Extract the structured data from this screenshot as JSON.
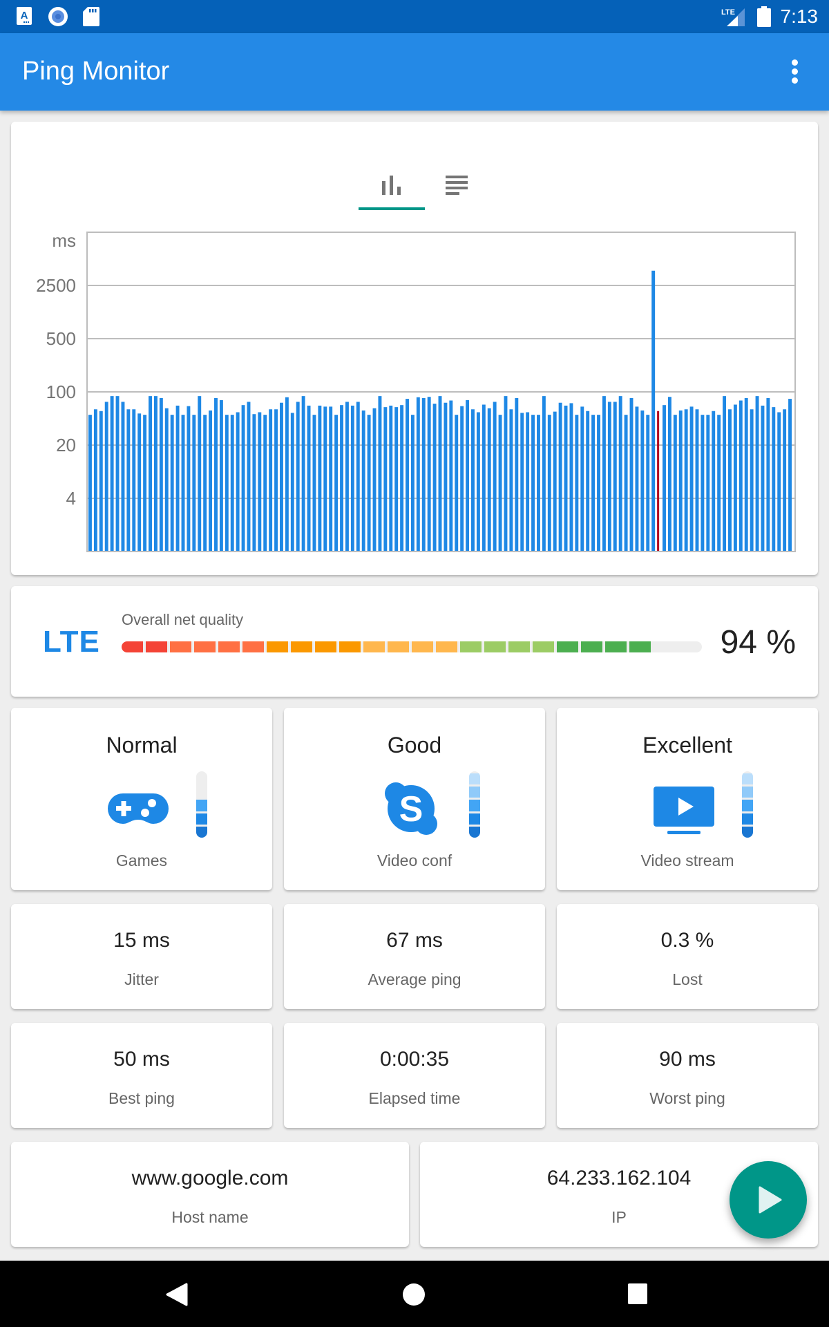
{
  "status_bar": {
    "time": "7:13",
    "left_icons": [
      "keyboard-a-icon",
      "record-icon",
      "sd-card-icon"
    ],
    "right_icons": [
      "lte-signal-icon",
      "battery-icon"
    ],
    "network": "LTE"
  },
  "app_bar": {
    "title": "Ping Monitor",
    "menu_icon": "more-vert-icon"
  },
  "chart_tabs": [
    {
      "icon": "bar-chart-icon",
      "selected": true
    },
    {
      "icon": "list-icon",
      "selected": false
    }
  ],
  "colors": {
    "primary": "#2489e6",
    "primary_dark": "#0561b8",
    "accent": "#009688",
    "bar": "#1e88e5",
    "lost_bar": "#b0001e"
  },
  "chart_data": {
    "type": "bar",
    "title": "",
    "xlabel": "",
    "ylabel": "ms",
    "y_scale": "log",
    "y_ticks": [
      4,
      20,
      100,
      500,
      2500
    ],
    "y_tick_labels": [
      "4",
      "20",
      "100",
      "500",
      "2500"
    ],
    "ylim": [
      0.8,
      12500
    ],
    "grid": true,
    "series": [
      {
        "name": "ping",
        "values": [
          50,
          59,
          56,
          74,
          88,
          88,
          74,
          59,
          59,
          52,
          50,
          88,
          88,
          83,
          61,
          50,
          66,
          50,
          65,
          50,
          88,
          50,
          57,
          83,
          78,
          50,
          50,
          54,
          67,
          74,
          51,
          54,
          50,
          59,
          59,
          72,
          85,
          53,
          74,
          88,
          66,
          50,
          66,
          64,
          64,
          50,
          67,
          74,
          66,
          74,
          57,
          50,
          61,
          88,
          63,
          66,
          63,
          67,
          81,
          50,
          85,
          83,
          86,
          70,
          88,
          72,
          77,
          50,
          65,
          78,
          59,
          54,
          68,
          61,
          74,
          50,
          88,
          59,
          83,
          53,
          54,
          50,
          50,
          88,
          50,
          55,
          72,
          66,
          71,
          50,
          64,
          56,
          50,
          50,
          88,
          74,
          74,
          88,
          50,
          83,
          64,
          57,
          50,
          3900,
          56,
          67,
          86,
          50,
          57,
          59,
          64,
          59,
          50,
          50,
          56,
          50,
          88,
          59,
          68,
          77,
          83,
          59,
          88,
          66,
          83,
          63,
          54,
          59,
          81
        ],
        "lost_index": 104
      }
    ]
  },
  "quality": {
    "network_type": "LTE",
    "label": "Overall net quality",
    "percent_value": 94,
    "percent_text": "94 %",
    "segments_total": 24,
    "segment_colors": [
      "#f44336",
      "#f44336",
      "#ff7043",
      "#ff7043",
      "#ff7043",
      "#ff7043",
      "#fb9800",
      "#fb9800",
      "#fb9800",
      "#fb9800",
      "#ffb74d",
      "#ffb74d",
      "#ffb74d",
      "#ffb74d",
      "#9ccc65",
      "#9ccc65",
      "#9ccc65",
      "#9ccc65",
      "#4caf50",
      "#4caf50",
      "#4caf50",
      "#4caf50"
    ]
  },
  "apps": [
    {
      "level": "Normal",
      "name": "Games",
      "icon": "gamepad-icon",
      "meter_filled": 3,
      "meter_total": 5
    },
    {
      "level": "Good",
      "name": "Video conf",
      "icon": "skype-icon",
      "meter_filled": 5,
      "meter_total": 5
    },
    {
      "level": "Excellent",
      "name": "Video stream",
      "icon": "tv-play-icon",
      "meter_filled": 5,
      "meter_total": 5
    }
  ],
  "meter_colors": [
    "#1976d2",
    "#1e88e5",
    "#42a5f5",
    "#90caf9",
    "#bbdefb"
  ],
  "stats": [
    {
      "value": "15 ms",
      "label": "Jitter"
    },
    {
      "value": "67 ms",
      "label": "Average ping"
    },
    {
      "value": "0.3 %",
      "label": "Lost"
    },
    {
      "value": "50 ms",
      "label": "Best ping"
    },
    {
      "value": "0:00:35",
      "label": "Elapsed time"
    },
    {
      "value": "90 ms",
      "label": "Worst ping"
    }
  ],
  "host": {
    "value": "www.google.com",
    "label": "Host name"
  },
  "ip": {
    "value": "64.233.162.104",
    "label": "IP"
  },
  "fab": {
    "icon": "play-icon"
  },
  "nav_bar": {
    "buttons": [
      "back-icon",
      "home-icon",
      "recents-icon"
    ]
  }
}
